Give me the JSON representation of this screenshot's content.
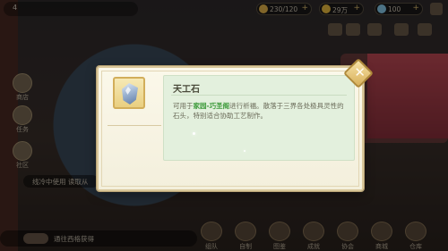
{
  "topbar": {
    "level": "4",
    "resources": [
      {
        "icon": "stamina-icon",
        "value": "230/120",
        "color": "#e8b84a"
      },
      {
        "icon": "coin-icon",
        "value": "29万",
        "color": "#f0c040"
      },
      {
        "icon": "diamond-icon",
        "value": "100",
        "color": "#8ad0f0"
      }
    ]
  },
  "background": {
    "status_text": "线冷中使用 读取从",
    "chat_text": "通往西格获得"
  },
  "bottom_nav": [
    "组队",
    "自制",
    "图鉴",
    "成就",
    "协会",
    "商城",
    "仓库"
  ],
  "left_nav": [
    "商店",
    "任务",
    "社区"
  ],
  "popup": {
    "item_icon": "gem-icon",
    "item_name": "天工石",
    "desc_prefix": "可用于",
    "desc_highlight": "家园-巧圣阁",
    "desc_rest": "进行祈福。散落于三界各处极具灵性的石头，特别适合协助工艺制作。",
    "close_icon": "close-icon"
  },
  "colors": {
    "highlight": "#3c9a3a",
    "panel_bg": "#e3f0dd",
    "popup_border": "#d9c79a"
  }
}
